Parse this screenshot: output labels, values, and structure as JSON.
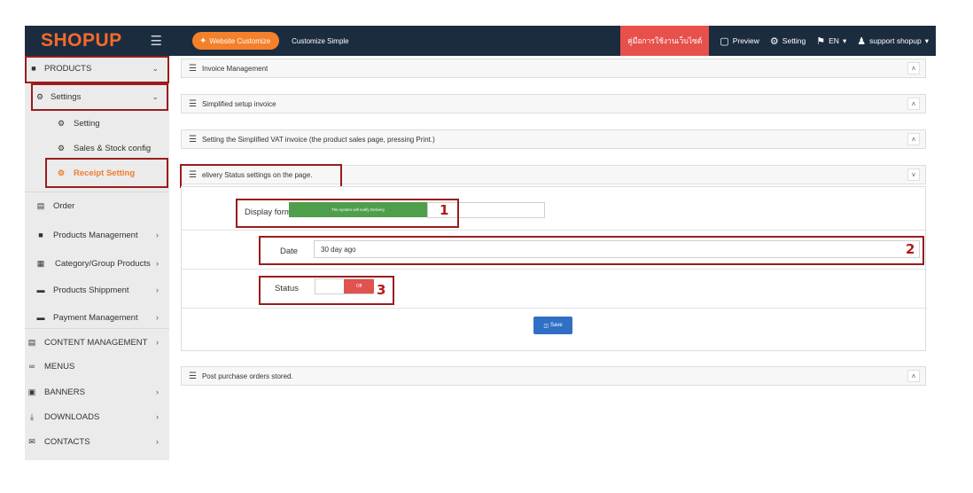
{
  "header": {
    "logo": "SHOPUP",
    "customize_button": "Website Customize",
    "customize_simple": "Customize Simple",
    "manual_button": "คู่มือการใช้งานเว็บไซต์",
    "preview": "Preview",
    "setting": "Setting",
    "language": "EN",
    "user": "support shopup"
  },
  "sidebar": {
    "products": "PRODUCTS",
    "settings": "Settings",
    "setting": "Setting",
    "sales_stock": "Sales & Stock config",
    "receipt_setting": "Receipt Setting",
    "order": "Order",
    "products_management": "Products Management",
    "category": "Category/Group Products",
    "shippment": "Products Shippment",
    "payment": "Payment Management",
    "content": "CONTENT MANAGEMENT",
    "menus": "MENUS",
    "banners": "BANNERS",
    "downloads": "DOWNLOADS",
    "contacts": "CONTACTS"
  },
  "panels": {
    "invoice": "Invoice Management",
    "simplified": "Simplified setup invoice",
    "vat": "Setting the Simplified VAT invoice (the product sales page, pressing Print.)",
    "delivery": "elivery Status settings on the page.",
    "post_purchase": "Post purchase orders stored."
  },
  "form": {
    "display_label": "Display format",
    "display_value": "The system will notify Delivery",
    "date_label": "Date",
    "date_value": "30 day ago",
    "status_label": "Status",
    "status_value": "Off",
    "save": "Save"
  },
  "annotations": {
    "n1": "1",
    "n2": "2",
    "n3": "3"
  },
  "colors": {
    "topbar": "#1c2c3f",
    "accent": "#f26b2b",
    "manual": "#e8504b",
    "green": "#4f9e4b",
    "toggle_off": "#e0534f",
    "save": "#2f70c5",
    "annotation": "#9a1c1c"
  }
}
